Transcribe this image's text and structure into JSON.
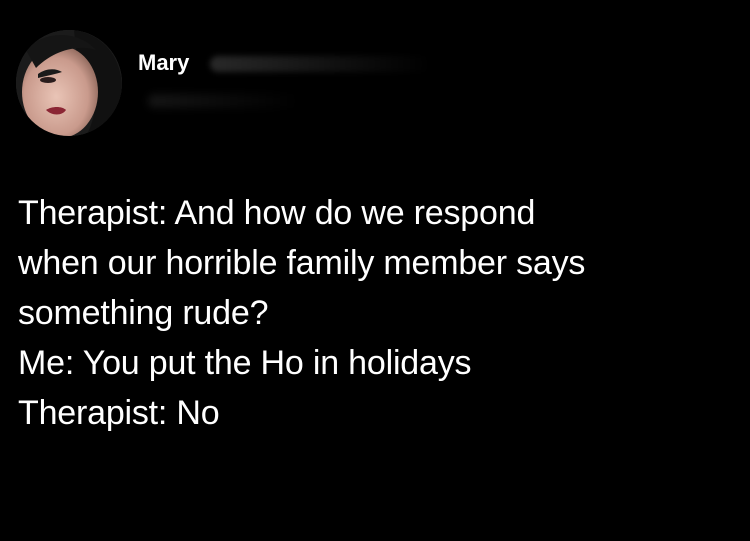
{
  "tweet": {
    "author": {
      "display_name": "Mary"
    },
    "lines": [
      "Therapist: And how do we respond",
      "when our horrible family member says",
      "something rude?",
      "Me: You put the Ho in holidays",
      "Therapist: No"
    ]
  },
  "colors": {
    "background": "#000000",
    "text": "#ffffff"
  },
  "icons": {
    "avatar": "avatar-photo"
  }
}
